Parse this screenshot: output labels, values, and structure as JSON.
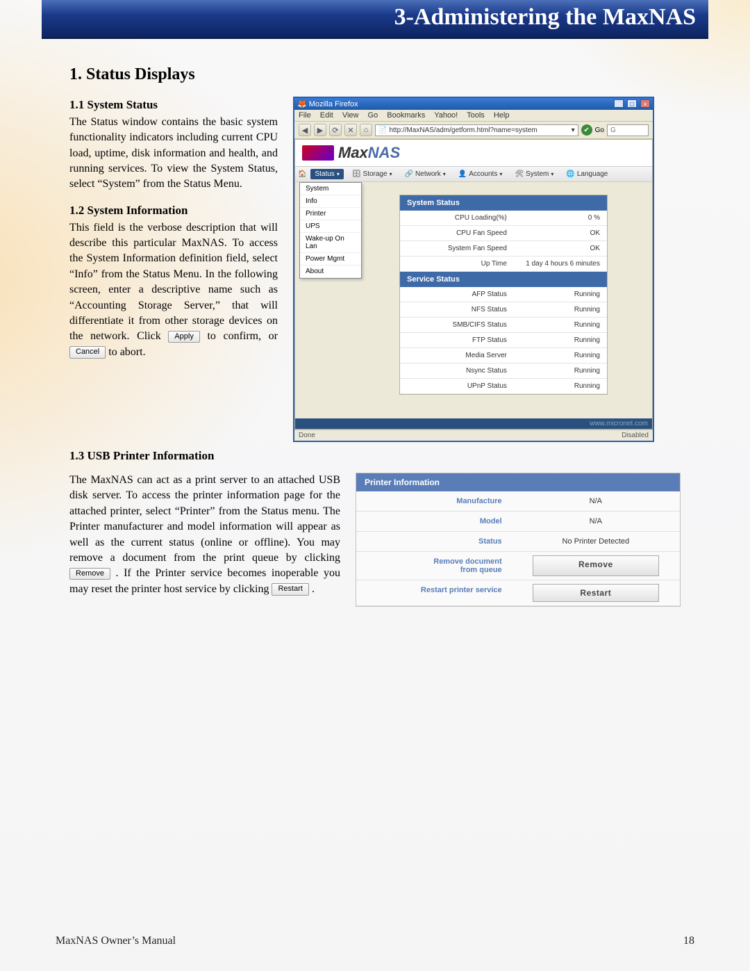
{
  "chapter_title": "3-Administering the MaxNAS",
  "section_heading": "1. Status Displays",
  "s11": {
    "head": "1.1 System Status",
    "body": "The Status window contains the basic system functionality indicators including current CPU load, uptime, disk information and health, and running services. To view the System Status, select “System” from the Status Menu."
  },
  "s12": {
    "head": "1.2 System Information",
    "body_a": "This field is the verbose description that will describe this particular MaxNAS. To access the System Information definition field, select “Info” from the Status Menu. In the following screen, enter a descriptive name such as “Accounting Storage Server,” that will differentiate it from other storage devices on the network. Click ",
    "apply_btn": "Apply",
    "body_b": " to confirm, or ",
    "cancel_btn": "Cancel",
    "body_c": " to abort."
  },
  "s13": {
    "head": "1.3 USB Printer Information",
    "body_a": "The MaxNAS can act as a print server to an attached USB disk server. To access the printer information page for the attached printer, select “Printer” from the Status menu. The Printer manufacturer and model information will appear as well as the current status (online or offline). You may remove a document from the print queue by clicking ",
    "remove_btn": "Remove",
    "body_b": ". If the Printer service becomes inoperable you may reset the printer host service by clicking ",
    "restart_btn": "Restart",
    "body_c": " ."
  },
  "firefox": {
    "title": "Mozilla Firefox",
    "menu": [
      "File",
      "Edit",
      "View",
      "Go",
      "Bookmarks",
      "Yahoo!",
      "Tools",
      "Help"
    ],
    "url": "http://MaxNAS/adm/getform.html?name=system",
    "go_label": "Go",
    "search_placeholder": "G",
    "brand_a": "Max",
    "brand_b": "NAS",
    "nav": [
      "Status",
      "Storage",
      "Network",
      "Accounts",
      "System",
      "Language"
    ],
    "dropdown": [
      "System",
      "Info",
      "Printer",
      "UPS",
      "Wake-up On Lan",
      "Power Mgmt",
      "About"
    ],
    "system_status_head": "System Status",
    "system_status_rows": [
      [
        "CPU Loading(%)",
        "0 %"
      ],
      [
        "CPU Fan Speed",
        "OK"
      ],
      [
        "System Fan Speed",
        "OK"
      ],
      [
        "Up Time",
        "1 day 4 hours 6 minutes"
      ]
    ],
    "service_status_head": "Service Status",
    "service_status_rows": [
      [
        "AFP Status",
        "Running"
      ],
      [
        "NFS Status",
        "Running"
      ],
      [
        "SMB/CIFS Status",
        "Running"
      ],
      [
        "FTP Status",
        "Running"
      ],
      [
        "Media Server",
        "Running"
      ],
      [
        "Nsync Status",
        "Running"
      ],
      [
        "UPnP Status",
        "Running"
      ]
    ],
    "micronet_link": "www.micronet.com",
    "status_left": "Done",
    "status_right": "Disabled"
  },
  "printer_panel": {
    "head": "Printer Information",
    "rows": [
      [
        "Manufacture",
        "N/A"
      ],
      [
        "Model",
        "N/A"
      ],
      [
        "Status",
        "No Printer Detected"
      ]
    ],
    "remove_label_a": "Remove document",
    "remove_label_b": "from queue",
    "remove_btn": "Remove",
    "restart_label": "Restart printer service",
    "restart_btn": "Restart"
  },
  "footer_left": "MaxNAS Owner’s Manual",
  "footer_right": "18"
}
